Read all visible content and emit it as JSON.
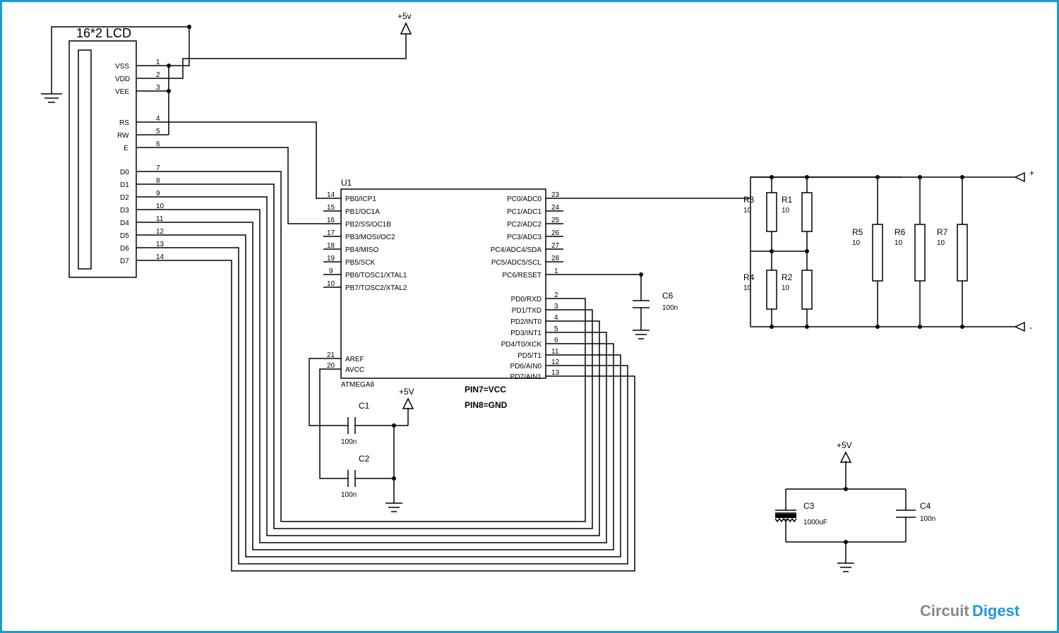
{
  "title_lcd": "16*2 LCD",
  "rail_5v": "+5V",
  "rail_5v_lower": "+5v",
  "ic": {
    "ref": "U1",
    "name": "ATMEGA8",
    "note1": "PIN7=VCC",
    "note2": "PIN8=GND",
    "left": [
      {
        "n": "14",
        "l": "PB0/ICP1"
      },
      {
        "n": "15",
        "l": "PB1/OC1A"
      },
      {
        "n": "16",
        "l": "PB2/SS/OC1B"
      },
      {
        "n": "17",
        "l": "PB3/MOSI/OC2"
      },
      {
        "n": "18",
        "l": "PB4/MISO"
      },
      {
        "n": "19",
        "l": "PB5/SCK"
      },
      {
        "n": "9",
        "l": "PB6/TOSC1/XTAL1"
      },
      {
        "n": "10",
        "l": "PB7/TOSC2/XTAL2"
      },
      {
        "n": "21",
        "l": "AREF"
      },
      {
        "n": "20",
        "l": "AVCC"
      }
    ],
    "right_top": [
      {
        "n": "23",
        "l": "PC0/ADC0"
      },
      {
        "n": "24",
        "l": "PC1/ADC1"
      },
      {
        "n": "25",
        "l": "PC2/ADC2"
      },
      {
        "n": "26",
        "l": "PC3/ADC3"
      },
      {
        "n": "27",
        "l": "PC4/ADC4/SDA"
      },
      {
        "n": "28",
        "l": "PC5/ADC5/SCL"
      },
      {
        "n": "1",
        "l": "PC6/RESET"
      }
    ],
    "right_bot": [
      {
        "n": "2",
        "l": "PD0/RXD"
      },
      {
        "n": "3",
        "l": "PD1/TXD"
      },
      {
        "n": "4",
        "l": "PD2/INT0"
      },
      {
        "n": "5",
        "l": "PD3/INT1"
      },
      {
        "n": "6",
        "l": "PD4/T0/XCK"
      },
      {
        "n": "11",
        "l": "PD5/T1"
      },
      {
        "n": "12",
        "l": "PD6/AIN0"
      },
      {
        "n": "13",
        "l": "PD7/AIN1"
      }
    ]
  },
  "lcd_pins": [
    {
      "n": "1",
      "l": "VSS"
    },
    {
      "n": "2",
      "l": "VDD"
    },
    {
      "n": "3",
      "l": "VEE"
    },
    {
      "n": "4",
      "l": "RS"
    },
    {
      "n": "5",
      "l": "RW"
    },
    {
      "n": "6",
      "l": "E"
    },
    {
      "n": "7",
      "l": "D0"
    },
    {
      "n": "8",
      "l": "D1"
    },
    {
      "n": "9",
      "l": "D2"
    },
    {
      "n": "10",
      "l": "D3"
    },
    {
      "n": "11",
      "l": "D4"
    },
    {
      "n": "12",
      "l": "D5"
    },
    {
      "n": "13",
      "l": "D6"
    },
    {
      "n": "14",
      "l": "D7"
    }
  ],
  "caps": {
    "c1": {
      "ref": "C1",
      "val": "100n"
    },
    "c2": {
      "ref": "C2",
      "val": "100n"
    },
    "c3": {
      "ref": "C3",
      "val": "1000uF"
    },
    "c4": {
      "ref": "C4",
      "val": "100n"
    },
    "c6": {
      "ref": "C6",
      "val": "100n"
    }
  },
  "res": {
    "r1": {
      "ref": "R1",
      "val": "10"
    },
    "r2": {
      "ref": "R2",
      "val": "10"
    },
    "r3": {
      "ref": "R3",
      "val": "10"
    },
    "r4": {
      "ref": "R4",
      "val": "10"
    },
    "r5": {
      "ref": "R5",
      "val": "10"
    },
    "r6": {
      "ref": "R6",
      "val": "10"
    },
    "r7": {
      "ref": "R7",
      "val": "10"
    }
  },
  "brand": {
    "a": "Circuit",
    "b": "Digest"
  }
}
